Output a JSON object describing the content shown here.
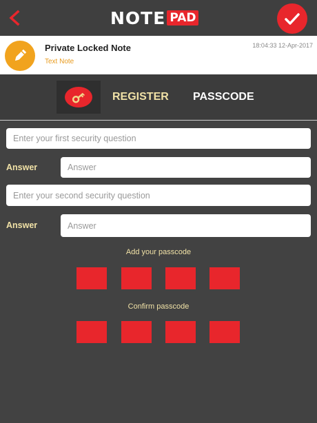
{
  "app": {
    "logo_main": "NOTE",
    "logo_badge": "PAD"
  },
  "note": {
    "title": "Private Locked Note",
    "type": "Text Note",
    "timestamp": "18:04:33 12-Apr-2017"
  },
  "tabs": {
    "register": "REGISTER",
    "passcode": "PASSCODE"
  },
  "form": {
    "question1_placeholder": "Enter your first security question",
    "answer1_label": "Answer",
    "answer1_placeholder": "Answer",
    "question2_placeholder": "Enter your second security question",
    "answer2_label": "Answer",
    "answer2_placeholder": "Answer",
    "add_passcode_label": "Add your passcode",
    "confirm_passcode_label": "Confirm passcode"
  },
  "icons": {
    "back": "chevron-left-icon",
    "confirm": "checkmark-icon",
    "note": "pencil-icon",
    "key": "key-icon"
  },
  "colors": {
    "accent_red": "#e8262c",
    "accent_orange": "#f1a31e",
    "label_cream": "#f0e1a6",
    "background": "#424242"
  }
}
